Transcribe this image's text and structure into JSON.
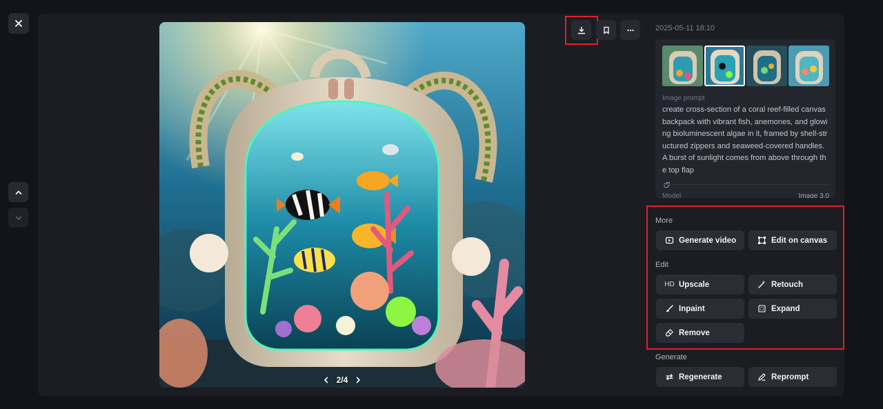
{
  "viewer": {
    "pager": {
      "current": "2",
      "total": "4",
      "text": "2/4"
    }
  },
  "sidebar": {
    "timestamp": "2025-05-11 18:10",
    "prompt_label": "Image prompt",
    "prompt_text": "create cross-section of a coral reef-filled canvas backpack with vibrant fish, anemones, and glowing bioluminescent algae in it, framed by shell-structured zippers and seaweed-covered handles. A burst of sunlight comes from above through the top flap",
    "model_label": "Model",
    "model_value": "Image 3.0"
  },
  "sections": {
    "more": {
      "label": "More",
      "buttons": [
        {
          "label": "Generate video",
          "icon": "video-icon"
        },
        {
          "label": "Edit on canvas",
          "icon": "canvas-icon"
        }
      ]
    },
    "edit": {
      "label": "Edit",
      "buttons": [
        {
          "label": "Upscale",
          "icon": "HD"
        },
        {
          "label": "Retouch",
          "icon": "wand-icon"
        },
        {
          "label": "Inpaint",
          "icon": "brush-icon"
        },
        {
          "label": "Expand",
          "icon": "expand-icon"
        },
        {
          "label": "Remove",
          "icon": "eraser-icon"
        }
      ]
    },
    "generate": {
      "label": "Generate",
      "buttons": [
        {
          "label": "Regenerate",
          "icon": "regenerate-icon"
        },
        {
          "label": "Reprompt",
          "icon": "pencil-icon"
        }
      ]
    }
  },
  "colors": {
    "background": "#12141a",
    "panel": "#1b1d23",
    "button": "#2a2d34",
    "highlight": "#e0212b"
  }
}
